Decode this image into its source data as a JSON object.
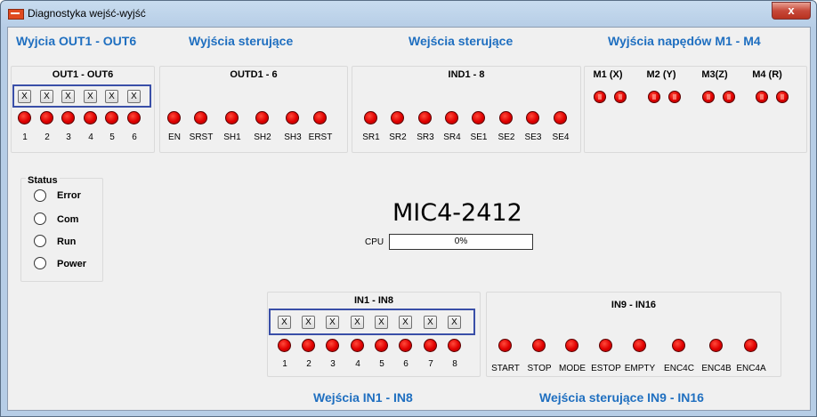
{
  "window": {
    "title": "Diagnostyka wejść-wyjść",
    "close_glyph": "x"
  },
  "headers": {
    "out1_6": "Wyjcia OUT1 - OUT6",
    "ctrl_outputs": "Wyjścia sterujące",
    "ctrl_inputs": "Wejścia sterujące",
    "drive_outputs": "Wyjścia napędów M1 - M4",
    "in1_8": "Wejścia IN1 - IN8",
    "in9_16": "Wejścia sterujące IN9 - IN16"
  },
  "out_panel": {
    "title": "OUT1 - OUT6",
    "toggles": [
      "X",
      "X",
      "X",
      "X",
      "X",
      "X"
    ],
    "labels": [
      "1",
      "2",
      "3",
      "4",
      "5",
      "6"
    ]
  },
  "outd_panel": {
    "title": "OUTD1 - 6",
    "labels": [
      "EN",
      "SRST",
      "SH1",
      "SH2",
      "SH3",
      "ERST"
    ]
  },
  "ind_panel": {
    "title": "IND1 - 8",
    "labels": [
      "SR1",
      "SR2",
      "SR3",
      "SR4",
      "SE1",
      "SE2",
      "SE3",
      "SE4"
    ]
  },
  "motors": {
    "labels": [
      "M1 (X)",
      "M2 (Y)",
      "M3(Z)",
      "M4 (R)"
    ]
  },
  "status": {
    "title": "Status",
    "items": [
      "Error",
      "Com",
      "Run",
      "Power"
    ]
  },
  "device": {
    "model": "MIC4-2412",
    "cpu_label": "CPU",
    "cpu_value": "0%"
  },
  "in_panel": {
    "title": "IN1 - IN8",
    "toggles": [
      "X",
      "X",
      "X",
      "X",
      "X",
      "X",
      "X",
      "X"
    ],
    "labels": [
      "1",
      "2",
      "3",
      "4",
      "5",
      "6",
      "7",
      "8"
    ]
  },
  "in9_panel": {
    "title": "IN9 - IN16",
    "labels": [
      "START",
      "STOP",
      "MODE",
      "ESTOP",
      "EMPTY",
      "ENC4C",
      "ENC4B",
      "ENC4A"
    ]
  },
  "colors": {
    "header_blue": "#1f6fc0",
    "led_red": "#e00000",
    "selection_border": "#3a4fa8",
    "close_red": "#c7493a"
  }
}
